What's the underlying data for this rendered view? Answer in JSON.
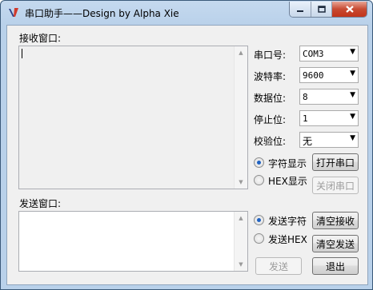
{
  "window": {
    "title": "串口助手——Design by Alpha Xie"
  },
  "receive": {
    "label": "接收窗口:"
  },
  "send": {
    "label": "发送窗口:"
  },
  "settings": [
    {
      "label": "串口号:",
      "value": "COM3"
    },
    {
      "label": "波特率:",
      "value": "9600"
    },
    {
      "label": "数据位:",
      "value": "8"
    },
    {
      "label": "停止位:",
      "value": "1"
    },
    {
      "label": "校验位:",
      "value": "无"
    }
  ],
  "recv_mode": {
    "char_label": "字符显示",
    "hex_label": "HEX显示",
    "selected": "char"
  },
  "send_mode": {
    "char_label": "发送字符",
    "hex_label": "发送HEX",
    "selected": "char"
  },
  "buttons": {
    "open_port": "打开串口",
    "close_port": "关闭串口",
    "clear_receive": "清空接收",
    "clear_send": "清空发送",
    "send": "发送",
    "exit": "退出"
  },
  "colors": {
    "accent_radio": "#1f62c2",
    "close_button": "#c74a32"
  }
}
